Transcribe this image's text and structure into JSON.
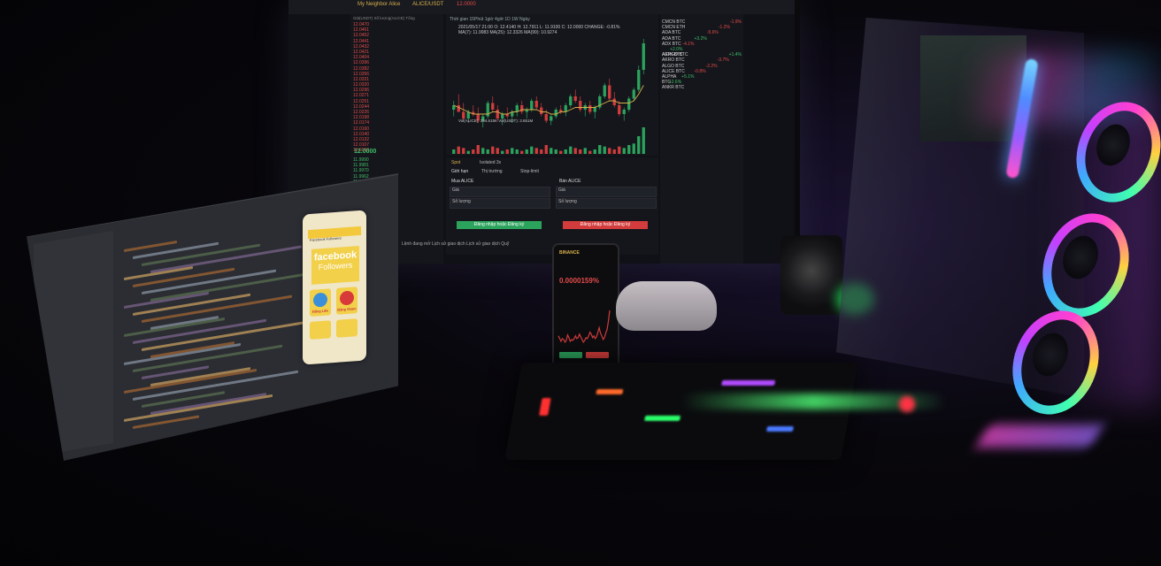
{
  "trading_screen": {
    "account_name": "My Neighbor Alice",
    "pair": "ALICE/USDT",
    "last_price": "12.0000",
    "chart_toolbar": "Thời gian  15Phút  1giờ  4giờ  1D  1W  Ngày",
    "chart_info": "2021/05/17 21:00  O: 12.4140  H: 12.7911  L: 11.9100  C: 12.0000  CHANGE: -0.81%",
    "ma_info": "MA(7): 11.9983  MA(25): 12.3326  MA(99): 10.9274",
    "volume_label": "Vol(ALICE): 394.615K  Vol(USDT): 3.651M",
    "tabs": {
      "spot": "Spot",
      "isolated": "Isolated 3x",
      "limit": "Giới hạn",
      "market": "Thị trường",
      "stop_limit": "Stop-limit"
    },
    "buy_title": "Mua ALICE",
    "sell_title": "Bán ALICE",
    "field_price": "Giá",
    "field_amount": "Số lượng",
    "buy_button": "Đăng nhập hoặc Đăng ký",
    "sell_button": "Đăng nhập hoặc Đăng ký",
    "bottom_tabs": "Lệnh đang mở   Lịch sử giao dịch   Lịch sử giao dịch   Quỹ",
    "orderbook_header": "Giá(USDT)   Số lượng(ALICE)   Tổng",
    "orderbook_sell": [
      "12.0470",
      "12.0461",
      "12.0452",
      "12.0441",
      "12.0432",
      "12.0421",
      "12.0404",
      "12.0396",
      "12.0382",
      "12.0356",
      "12.0331",
      "12.0320",
      "12.0296",
      "12.0271",
      "12.0251",
      "12.0244",
      "12.0226",
      "12.0198",
      "12.0174",
      "12.0160",
      "12.0140",
      "12.0132",
      "12.0107",
      "12.0098"
    ],
    "orderbook_buy": [
      "11.9990",
      "11.9981",
      "11.9970",
      "11.9962",
      "11.9951",
      "11.9940",
      "11.9927",
      "11.9915",
      "11.9908",
      "11.9893",
      "11.9881",
      "11.9870",
      "11.9862",
      "11.9850",
      "11.9842",
      "11.9836",
      "11.9827",
      "11.9811"
    ],
    "market_list": [
      {
        "pair": "CMCN BTC",
        "chg": "-1.9%"
      },
      {
        "pair": "CMCN ETH",
        "chg": "-1.2%"
      },
      {
        "pair": "ADA BTC",
        "chg": "-5.6%"
      },
      {
        "pair": "ADA BTC",
        "chg": "+3.2%"
      },
      {
        "pair": "ADX BTC",
        "chg": "-4.1%"
      },
      {
        "pair": "AERGO BTC",
        "chg": "+2.0%"
      },
      {
        "pair": "AION BTC",
        "chg": "+1.4%"
      },
      {
        "pair": "AKRO BTC",
        "chg": "-3.7%"
      },
      {
        "pair": "ALGO BTC",
        "chg": "-2.2%"
      },
      {
        "pair": "ALICE BTC",
        "chg": "-0.8%"
      },
      {
        "pair": "ALPHA BTC",
        "chg": "+5.1%"
      },
      {
        "pair": "ANKR BTC",
        "chg": "+2.6%"
      }
    ]
  },
  "emulator": {
    "app_bar": "Facebook Followers",
    "brand": "facebook",
    "subtitle": "Followers",
    "tile_1": "Đăng Like",
    "tile_2": "Đăng Share"
  },
  "phone": {
    "brand": "BINANCE",
    "price": "0.0000159%"
  },
  "colors": {
    "buy": "#2ca35c",
    "sell": "#d23c3c",
    "accent": "#d8b04a",
    "rgb_pink": "#ff3fd1",
    "rgb_blue": "#3fa9ff"
  },
  "chart_data": {
    "type": "candlestick",
    "title": "ALICE/USDT",
    "candles": [
      [
        9.2,
        9.6,
        8.9,
        9.4
      ],
      [
        9.4,
        9.9,
        9.1,
        9.1
      ],
      [
        9.1,
        9.5,
        8.7,
        8.8
      ],
      [
        8.8,
        9.2,
        8.6,
        9.1
      ],
      [
        9.1,
        9.4,
        8.9,
        9.0
      ],
      [
        9.0,
        9.3,
        8.6,
        8.7
      ],
      [
        8.7,
        9.0,
        8.4,
        8.9
      ],
      [
        8.9,
        9.6,
        8.8,
        9.5
      ],
      [
        9.5,
        9.8,
        9.1,
        9.2
      ],
      [
        9.2,
        9.4,
        8.7,
        8.8
      ],
      [
        8.8,
        9.1,
        8.5,
        9.0
      ],
      [
        9.0,
        9.3,
        8.8,
        8.9
      ],
      [
        8.9,
        9.2,
        8.6,
        9.1
      ],
      [
        9.1,
        9.5,
        8.9,
        9.4
      ],
      [
        9.4,
        9.6,
        9.0,
        9.1
      ],
      [
        9.1,
        9.3,
        8.8,
        9.2
      ],
      [
        9.2,
        9.7,
        9.1,
        9.6
      ],
      [
        9.6,
        9.8,
        9.2,
        9.3
      ],
      [
        9.3,
        9.5,
        8.9,
        9.0
      ],
      [
        9.0,
        9.2,
        8.6,
        8.7
      ],
      [
        8.7,
        9.0,
        8.5,
        8.9
      ],
      [
        8.9,
        9.3,
        8.8,
        9.2
      ],
      [
        9.2,
        9.4,
        9.0,
        9.1
      ],
      [
        9.1,
        9.5,
        8.9,
        9.4
      ],
      [
        9.4,
        9.9,
        9.3,
        9.8
      ],
      [
        9.8,
        10.1,
        9.5,
        9.6
      ],
      [
        9.6,
        9.8,
        9.1,
        9.2
      ],
      [
        9.2,
        9.5,
        8.9,
        9.4
      ],
      [
        9.4,
        9.6,
        9.0,
        9.1
      ],
      [
        9.1,
        9.4,
        8.8,
        9.3
      ],
      [
        9.3,
        9.9,
        9.2,
        9.8
      ],
      [
        9.8,
        10.4,
        9.7,
        10.3
      ],
      [
        10.3,
        10.6,
        9.6,
        9.7
      ],
      [
        9.7,
        10.0,
        9.3,
        9.4
      ],
      [
        9.4,
        9.6,
        8.9,
        9.0
      ],
      [
        9.0,
        9.3,
        8.7,
        9.2
      ],
      [
        9.2,
        9.8,
        9.1,
        9.7
      ],
      [
        9.7,
        10.2,
        9.6,
        10.1
      ],
      [
        10.1,
        11.2,
        10.0,
        11.0
      ],
      [
        11.0,
        12.4,
        10.8,
        12.2
      ]
    ],
    "ma": [
      9.4,
      9.3,
      9.2,
      9.1,
      9.0,
      9.0,
      9.0,
      9.0,
      9.1,
      9.1,
      9.0,
      9.0,
      9.1,
      9.1,
      9.2,
      9.2,
      9.2,
      9.2,
      9.1,
      9.1,
      9.0,
      9.0,
      9.1,
      9.1,
      9.2,
      9.3,
      9.3,
      9.3,
      9.3,
      9.3,
      9.4,
      9.5,
      9.6,
      9.6,
      9.5,
      9.5,
      9.5,
      9.6,
      9.9,
      10.3
    ],
    "volume": [
      3,
      5,
      4,
      2,
      3,
      6,
      4,
      3,
      5,
      4,
      2,
      3,
      4,
      3,
      2,
      3,
      5,
      4,
      3,
      6,
      4,
      3,
      2,
      3,
      5,
      4,
      3,
      4,
      2,
      3,
      6,
      5,
      4,
      3,
      5,
      4,
      6,
      7,
      12,
      18
    ]
  }
}
